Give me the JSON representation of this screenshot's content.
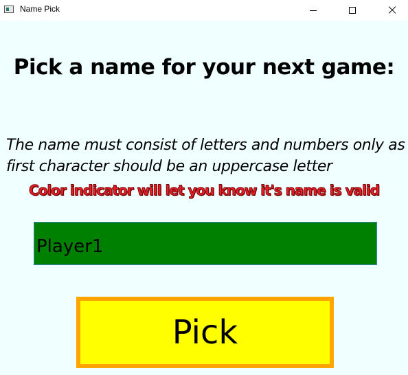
{
  "window": {
    "title": "Name Pick",
    "icon": "app-window-icon",
    "controls": [
      "minimize-icon",
      "maximize-icon",
      "close-icon"
    ]
  },
  "main": {
    "heading": "Pick a name for your next game:",
    "instructions_line1": "The name must consist of letters and numbers only as",
    "instructions_line2": "first character should be an uppercase letter",
    "indicator_note": "Color indicator will let you know it's name is valid",
    "name_input": {
      "value": "Player1",
      "valid_color": "#008000"
    },
    "pick_button_label": "Pick"
  },
  "colors": {
    "background": "#f0ffff",
    "button_fill": "#ffff00",
    "button_border": "#ffa500",
    "note_text": "#e8202a"
  }
}
